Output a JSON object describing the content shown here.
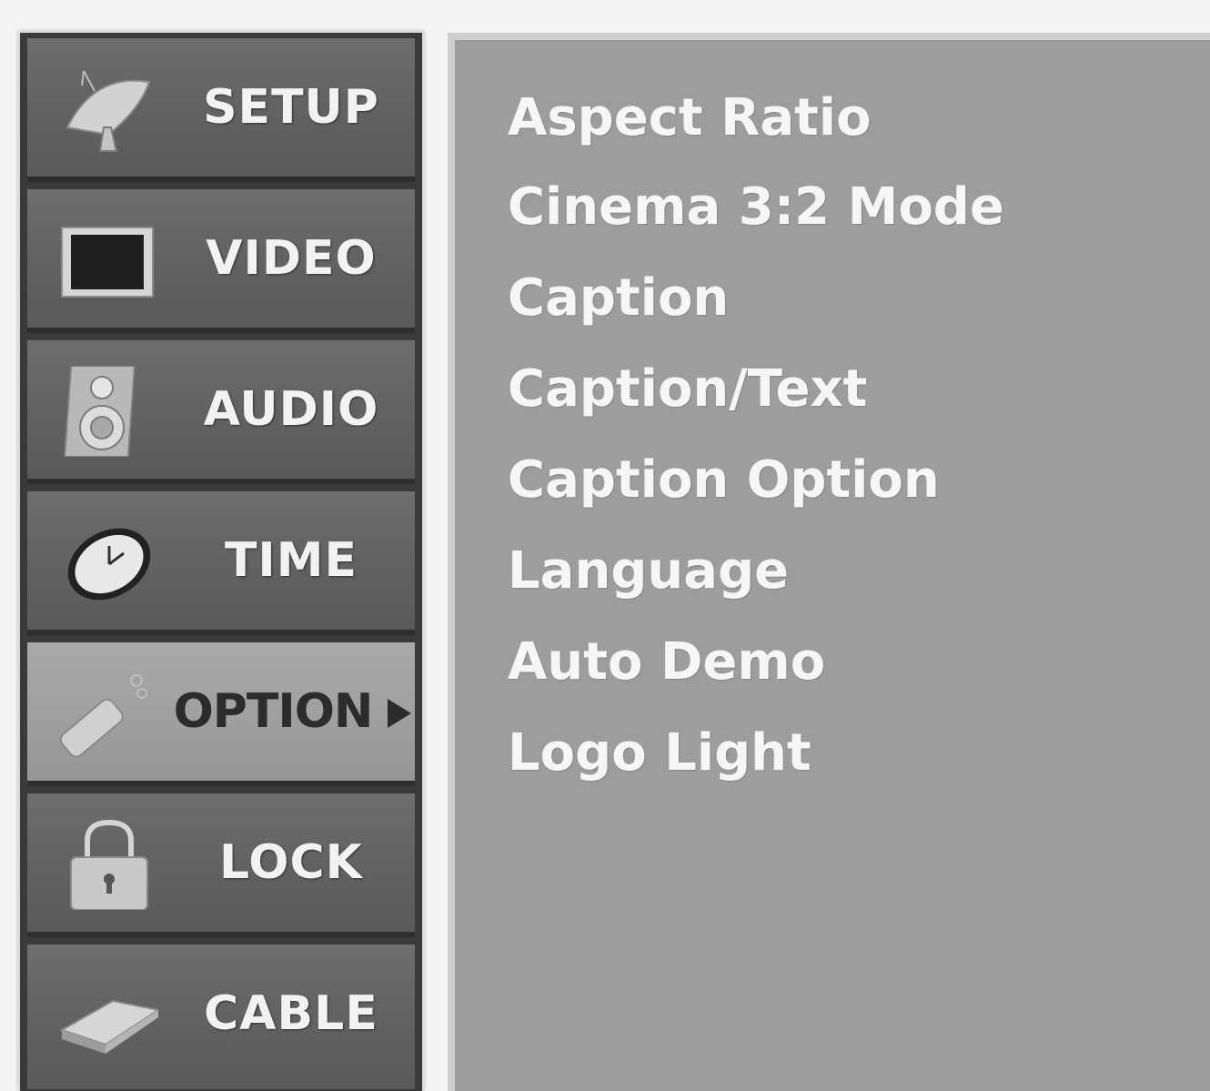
{
  "menu": {
    "items": [
      {
        "label": "SETUP",
        "icon": "satellite-dish-icon",
        "selected": false
      },
      {
        "label": "VIDEO",
        "icon": "tv-screen-icon",
        "selected": false
      },
      {
        "label": "AUDIO",
        "icon": "speaker-icon",
        "selected": false
      },
      {
        "label": "TIME",
        "icon": "clock-icon",
        "selected": false
      },
      {
        "label": "OPTION",
        "icon": "remote-control-icon",
        "selected": true
      },
      {
        "label": "LOCK",
        "icon": "padlock-icon",
        "selected": false
      },
      {
        "label": "CABLE",
        "icon": "cable-card-icon",
        "selected": false
      }
    ]
  },
  "submenu": {
    "items": [
      {
        "label": "Aspect Ratio"
      },
      {
        "label": "Cinema 3:2 Mode"
      },
      {
        "label": "Caption"
      },
      {
        "label": "Caption/Text"
      },
      {
        "label": "Caption Option"
      },
      {
        "label": "Language"
      },
      {
        "label": "Auto Demo"
      },
      {
        "label": "Logo Light"
      }
    ]
  },
  "colors": {
    "menu_item": "#666666",
    "menu_item_selected": "#a3a3a3",
    "submenu_background": "#9d9d9d",
    "text_light": "#f2f2f2",
    "text_dark": "#2c2c2c"
  }
}
